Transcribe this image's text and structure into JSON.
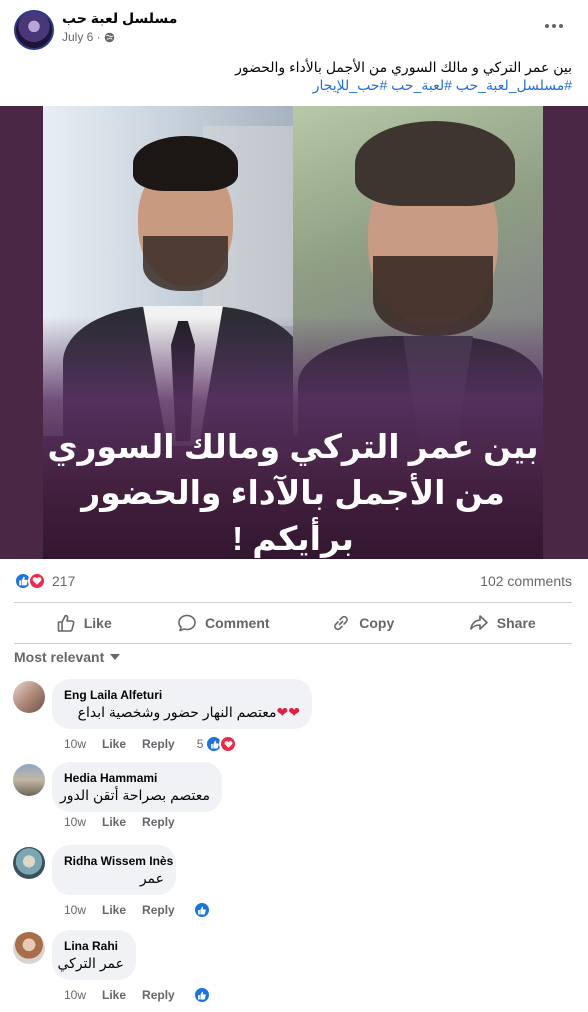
{
  "post": {
    "page_name": "مسلسل لعبة حب",
    "date": "July 6 ·",
    "caption": "بين عمر التركي و مالك السوري من الأجمل بالأداء والحضور",
    "hashtags": "#مسلسل_لعبة_حب #لعبة_حب #حب_للإيجار",
    "image_text_line1": "بين عمر التركي ومالك السوري",
    "image_text_line2": "من الأجمل بالآداء والحضور برأيكم !"
  },
  "stats": {
    "reactions_count": "217",
    "comments_count": "102 comments"
  },
  "actions": {
    "like": "Like",
    "comment": "Comment",
    "copy": "Copy",
    "share": "Share"
  },
  "sort": {
    "label": "Most relevant"
  },
  "comments": [
    {
      "name": "Eng Laila Alfeturi",
      "text": "معتصم النهار حضور وشخصية ابداع",
      "time": "10w",
      "like": "Like",
      "reply": "Reply",
      "reactions": "5"
    },
    {
      "name": "Hedia Hammami",
      "text": "معتصم بصراحة أتقن الدور",
      "time": "10w",
      "like": "Like",
      "reply": "Reply"
    },
    {
      "name": "Ridha Wissem Inès",
      "text": "عمر",
      "time": "10w",
      "like": "Like",
      "reply": "Reply"
    },
    {
      "name": "Lina Rahi",
      "text": "عمر التركي",
      "time": "10w",
      "like": "Like",
      "reply": "Reply"
    }
  ],
  "icons": {
    "globe": "globe-icon",
    "more": "more-options-icon",
    "like": "thumbs-up-icon",
    "love": "heart-icon",
    "comment": "comment-bubble-icon",
    "copy": "link-icon",
    "share": "share-arrow-icon",
    "sort": "chevron-down-icon"
  },
  "colors": {
    "accent_blue": "#1b74e4",
    "love_red": "#f0284a",
    "hashtag_blue": "#216fdb",
    "secondary_text": "#65676b",
    "bubble_bg": "#f0f2f5"
  }
}
